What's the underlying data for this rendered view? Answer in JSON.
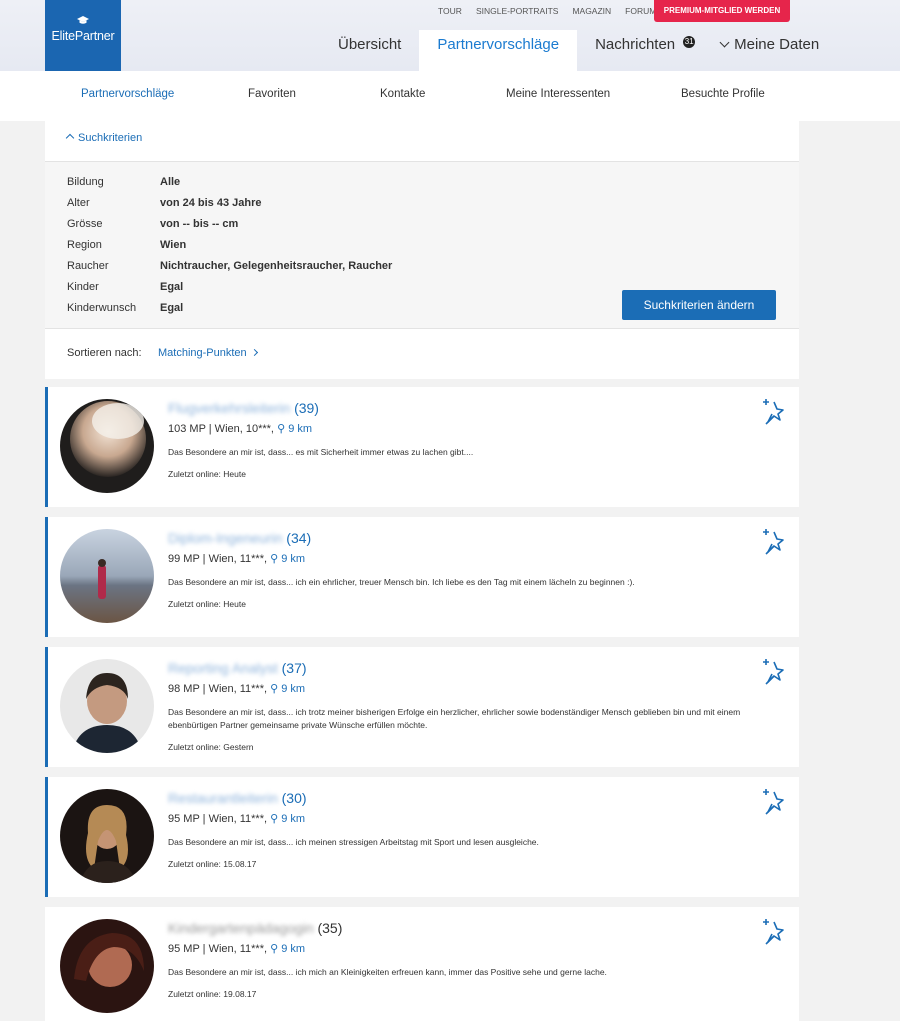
{
  "header": {
    "logo_text": "ElitePartner",
    "top_links": [
      "TOUR",
      "SINGLE-PORTRAITS",
      "MAGAZIN",
      "FORUM"
    ],
    "premium_label": "PREMIUM-MITGLIED WERDEN",
    "tabs": [
      {
        "label": "Übersicht"
      },
      {
        "label": "Partnervorschläge"
      },
      {
        "label": "Nachrichten"
      },
      {
        "label": "Meine Daten"
      }
    ],
    "messages_badge": "31"
  },
  "subnav": {
    "items": [
      "Partnervorschläge",
      "Favoriten",
      "Kontakte",
      "Meine Interessenten",
      "Besuchte Profile"
    ]
  },
  "criteria": {
    "toggle_label": "Suchkriterien",
    "rows": [
      {
        "label": "Bildung",
        "value": "Alle"
      },
      {
        "label": "Alter",
        "value": "von 24 bis 43 Jahre"
      },
      {
        "label": "Grösse",
        "value": "von -- bis -- cm"
      },
      {
        "label": "Region",
        "value": "Wien"
      },
      {
        "label": "Raucher",
        "value": "Nichtraucher, Gelegenheitsraucher, Raucher"
      },
      {
        "label": "Kinder",
        "value": "Egal"
      },
      {
        "label": "Kinderwunsch",
        "value": "Egal"
      }
    ],
    "change_button": "Suchkriterien ändern"
  },
  "sort": {
    "label": "Sortieren nach:",
    "value": "Matching-Punkten"
  },
  "profiles": [
    {
      "name": "Flugverkehrsleiterin",
      "age": "(39)",
      "meta": "103 MP | Wien, 10***,",
      "distance": "9 km",
      "desc": "Das Besondere an mir ist, dass... es mit Sicherheit immer etwas zu lachen gibt....",
      "online": "Zuletzt online: Heute"
    },
    {
      "name": "Diplom-Ingeneurin",
      "age": "(34)",
      "meta": "99 MP | Wien, 11***,",
      "distance": "9 km",
      "desc": "Das Besondere an mir ist, dass... ich ein ehrlicher, treuer Mensch bin. Ich liebe es den Tag mit einem lächeln zu beginnen :).",
      "online": "Zuletzt online: Heute"
    },
    {
      "name": "Reporting Analyst",
      "age": "(37)",
      "meta": "98 MP | Wien, 11***,",
      "distance": "9 km",
      "desc": "Das Besondere an mir ist, dass... ich trotz meiner bisherigen Erfolge ein herzlicher, ehrlicher sowie bodenständiger Mensch geblieben bin und mit einem ebenbürtigen Partner gemeinsame private Wünsche erfüllen möchte.",
      "online": "Zuletzt online: Gestern"
    },
    {
      "name": "Restaurantleiterin",
      "age": "(30)",
      "meta": "95 MP | Wien, 11***,",
      "distance": "9 km",
      "desc": "Das Besondere an mir ist, dass... ich meinen stressigen Arbeitstag mit Sport und lesen ausgleiche.",
      "online": "Zuletzt online: 15.08.17"
    },
    {
      "name": "Kindergartenpädagogin",
      "age": "(35)",
      "meta": "95 MP | Wien, 11***,",
      "distance": "9 km",
      "desc": "Das Besondere an mir ist, dass... ich mich an Kleinigkeiten erfreuen kann, immer das Positive sehe und gerne lache.",
      "online": "Zuletzt online: 19.08.17"
    }
  ],
  "icons": {
    "graduation": "graduation-cap-icon",
    "favorite": "sparkle-pin-icon",
    "location": "location-pin-icon"
  },
  "colors": {
    "brand_blue": "#1b66b1",
    "link_blue": "#1b6db6",
    "premium_red": "#e6254b"
  }
}
